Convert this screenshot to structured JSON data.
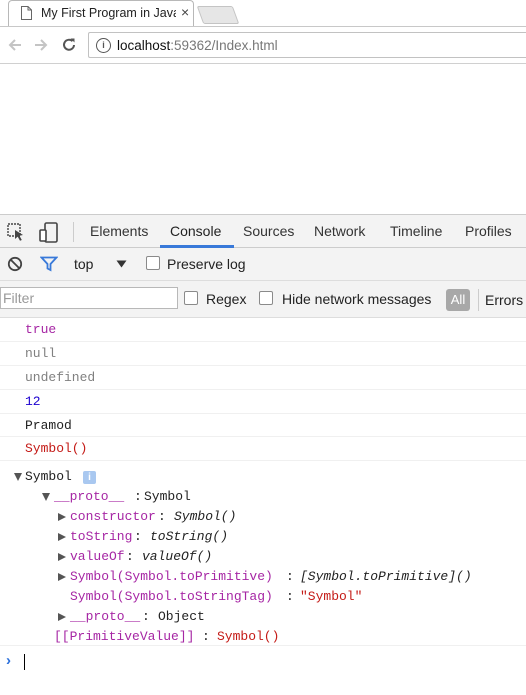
{
  "browser": {
    "tab_title": "My First Program in JavaScript",
    "close_glyph": "×",
    "url_host": "localhost",
    "url_rest": ":59362/Index.html"
  },
  "devtools": {
    "tabs": [
      "Elements",
      "Console",
      "Sources",
      "Network",
      "Timeline",
      "Profiles"
    ],
    "active_tab": "Console",
    "context": "top",
    "preserve_log_label": "Preserve log",
    "filter_placeholder": "Filter",
    "regex_label": "Regex",
    "hide_network_label": "Hide network messages",
    "all_label": "All",
    "errors_label": "Errors"
  },
  "console": {
    "lines": [
      {
        "text": "true",
        "color": "#a626a4"
      },
      {
        "text": "null",
        "color": "#808080"
      },
      {
        "text": "undefined",
        "color": "#808080"
      },
      {
        "text": "12",
        "color": "#1c00cf"
      },
      {
        "text": "Pramod",
        "color": "#222222"
      },
      {
        "text": "Symbol()",
        "color": "#c41a16"
      }
    ],
    "tree": {
      "root": "Symbol",
      "info_glyph": "i",
      "proto_key": "__proto__",
      "proto_value": "Symbol",
      "children": [
        {
          "key": "constructor",
          "value": "Symbol()",
          "expandable": true,
          "italic": true,
          "value_color": "#222222"
        },
        {
          "key": "toString",
          "value": "toString()",
          "expandable": true,
          "italic": true,
          "value_color": "#222222"
        },
        {
          "key": "valueOf",
          "value": "valueOf()",
          "expandable": true,
          "italic": true,
          "value_color": "#222222"
        },
        {
          "key": "Symbol(Symbol.toPrimitive)",
          "value": "[Symbol.toPrimitive]()",
          "expandable": true,
          "italic": true,
          "value_color": "#222222"
        },
        {
          "key": "Symbol(Symbol.toStringTag)",
          "value": "\"Symbol\"",
          "expandable": false,
          "italic": false,
          "value_color": "#c41a16"
        },
        {
          "key": "__proto__",
          "value": "Object",
          "expandable": true,
          "italic": false,
          "value_color": "#222222"
        }
      ],
      "primitive_key": "[[PrimitiveValue]]",
      "primitive_value": "Symbol()"
    },
    "prompt_glyph": "›"
  },
  "colors": {
    "accent": "#3879d9",
    "key": "#a626a4",
    "string": "#c41a16"
  }
}
